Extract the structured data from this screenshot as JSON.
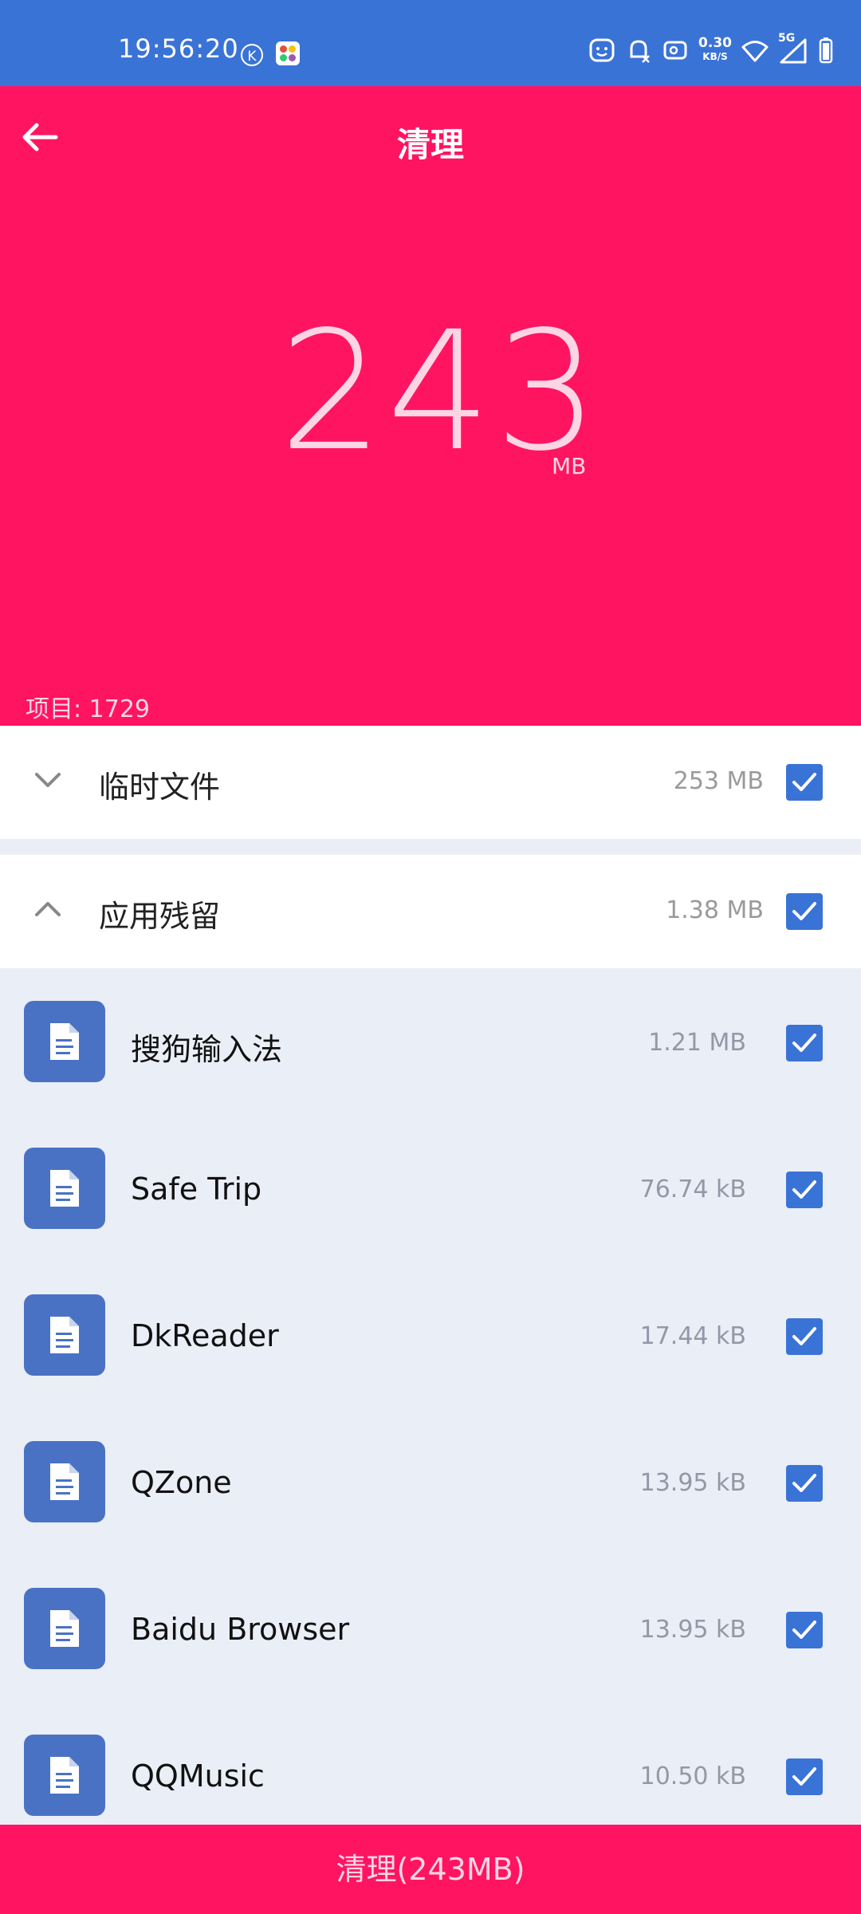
{
  "status_bar": {
    "time": "19:56:20",
    "k_badge": "K",
    "net_speed_value": "0.30",
    "net_speed_unit": "KB/S",
    "signal_label": "5G"
  },
  "header": {
    "title": "清理",
    "total_size_number": "243",
    "total_size_unit": "MB",
    "items_label": "项目: 1729"
  },
  "categories": [
    {
      "label": "临时文件",
      "size": "253 MB",
      "expanded": false,
      "checked": true
    },
    {
      "label": "应用残留",
      "size": "1.38 MB",
      "expanded": true,
      "checked": true
    }
  ],
  "apps": [
    {
      "name": "搜狗输入法",
      "size": "1.21 MB",
      "checked": true,
      "icon": "document-icon"
    },
    {
      "name": "Safe Trip",
      "size": "76.74 kB",
      "checked": true,
      "icon": "document-icon"
    },
    {
      "name": "DkReader",
      "size": "17.44 kB",
      "checked": true,
      "icon": "document-icon"
    },
    {
      "name": "QZone",
      "size": "13.95 kB",
      "checked": true,
      "icon": "document-icon"
    },
    {
      "name": "Baidu Browser",
      "size": "13.95 kB",
      "checked": true,
      "icon": "document-icon"
    },
    {
      "name": "QQMusic",
      "size": "10.50 kB",
      "checked": true,
      "icon": "document-icon"
    }
  ],
  "bottom_button": {
    "label": "清理(243MB)"
  },
  "colors": {
    "status_bar": "#3a73d6",
    "accent_pink": "#ff1462",
    "checkbox_blue": "#3a73d6",
    "list_bg": "#eaeef7",
    "app_icon_bg": "#4a72c4"
  }
}
